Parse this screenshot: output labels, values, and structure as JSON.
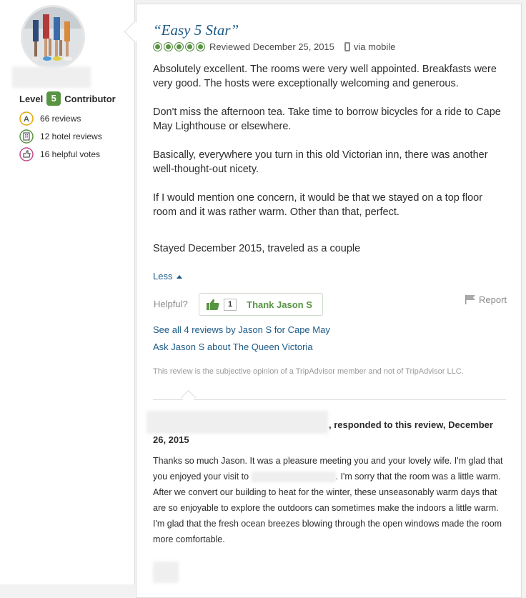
{
  "reviewer": {
    "level_label": "Level",
    "level": "5",
    "contributor_label": "Contributor",
    "stats": [
      {
        "icon": "contributor-icon",
        "text": "66 reviews"
      },
      {
        "icon": "hotel-icon",
        "text": "12 hotel reviews"
      },
      {
        "icon": "helpful-votes-icon",
        "text": "16 helpful votes"
      }
    ]
  },
  "review": {
    "title": "“Easy 5 Star”",
    "rating": 5,
    "reviewed": "Reviewed December 25, 2015",
    "via": "via mobile",
    "paragraphs": [
      "Absolutely excellent. The rooms were very well appointed. Breakfasts were very good. The hosts were exceptionally welcoming and generous.",
      "Don't miss the afternoon tea. Take time to borrow bicycles for a ride to Cape May Lighthouse or elsewhere.",
      "Basically, everywhere you turn in this old Victorian inn, there was another well-thought-out nicety.",
      "If I would mention one concern, it would be that we stayed on a top floor room and it was rather warm. Other than that, perfect."
    ],
    "stayed": "Stayed December 2015, traveled as a couple",
    "less": "Less",
    "helpful_label": "Helpful?",
    "thank_count": "1",
    "thank_label": "Thank Jason S",
    "report_label": "Report",
    "see_all": "See all 4 reviews by Jason S for Cape May",
    "ask": "Ask Jason S about The Queen Victoria",
    "disclaimer": "This review is the subjective opinion of a TripAdvisor member and not of TripAdvisor LLC."
  },
  "response": {
    "heading": ", responded to this review, December 26, 2015",
    "text_before": "Thanks so much Jason. It was a pleasure meeting you and your lovely wife. I'm glad that you enjoyed your visit to ",
    "text_after": ". I'm sorry that the room was a little warm. After we convert our building to heat for the winter, these unseasonably warm days that are so enjoyable to explore the outdoors can sometimes make the indoors a little warm. I'm glad that the fresh ocean breezes blowing through the open windows made the room more comfortable."
  },
  "colors": {
    "accent_green": "#589442",
    "link_blue": "#1b5a87"
  }
}
